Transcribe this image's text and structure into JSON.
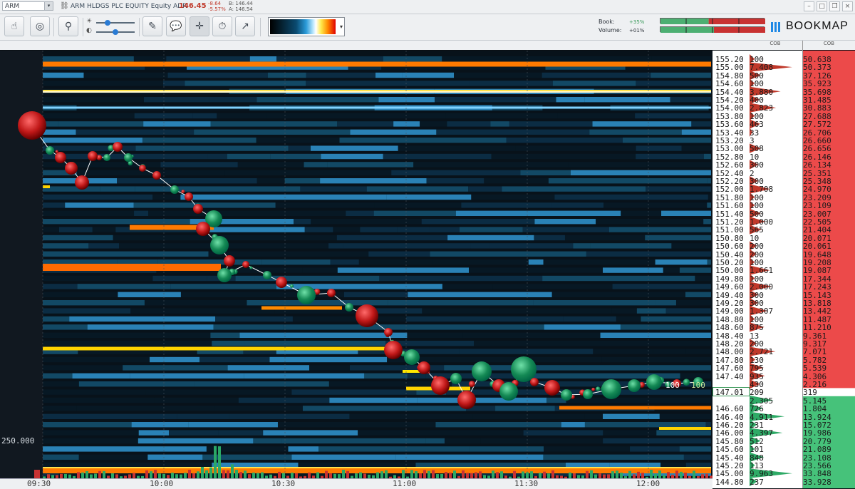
{
  "header": {
    "symbol": "ARM",
    "instrument": "ARM HLDGS PLC EQUITY Equity ADR",
    "last_price": "146.45",
    "change_abs": "-8.64",
    "change_pct": "-5.57%",
    "bid_label": "B: 146.44",
    "ask_label": "A: 146.54"
  },
  "toolbar": {
    "book_label": "Book:",
    "book_value": "+35%",
    "volume_label": "Volume:",
    "volume_value": "+01%",
    "logo_text": "BOOKMAP",
    "book_split": 0.46,
    "volume_split": 0.51,
    "colors": {
      "buy": "#4caf72",
      "sell": "#c83232"
    }
  },
  "icons": [
    "hand-icon",
    "recenter-icon",
    "broom-icon",
    "brightness-icon",
    "contrast-icon",
    "pencil-icon",
    "chat-icon",
    "crosshair-icon",
    "stopwatch-icon",
    "indicator-icon"
  ],
  "chart": {
    "volume_scale_label": "250.000",
    "trade_label_a": "100",
    "trade_label_b": "100",
    "time_ticks": [
      "09:30",
      "10:00",
      "10:30",
      "11:00",
      "11:30",
      "12:00"
    ]
  },
  "ladder": {
    "header_left": "COB",
    "header_right": "COB",
    "current_price": "147.01",
    "current_size": "209",
    "current_cob": "319",
    "asks": [
      {
        "price": "155.20",
        "size": "100",
        "cob": "50.638"
      },
      {
        "price": "155.00",
        "size": "7.408",
        "cob": "50.373"
      },
      {
        "price": "154.80",
        "size": "500",
        "cob": "37.126"
      },
      {
        "price": "154.60",
        "size": "100",
        "cob": "35.923"
      },
      {
        "price": "154.40",
        "size": "3.880",
        "cob": "35.698"
      },
      {
        "price": "154.20",
        "size": "400",
        "cob": "31.485"
      },
      {
        "price": "154.00",
        "size": "2.823",
        "cob": "30.883"
      },
      {
        "price": "153.80",
        "size": "100",
        "cob": "27.688"
      },
      {
        "price": "153.60",
        "size": "463",
        "cob": "27.572"
      },
      {
        "price": "153.40",
        "size": "33",
        "cob": "26.706"
      },
      {
        "price": "153.20",
        "size": "3",
        "cob": "26.660"
      },
      {
        "price": "153.00",
        "size": "508",
        "cob": "26.656"
      },
      {
        "price": "152.80",
        "size": "10",
        "cob": "26.146"
      },
      {
        "price": "152.60",
        "size": "300",
        "cob": "26.134"
      },
      {
        "price": "152.40",
        "size": "2",
        "cob": "25.351"
      },
      {
        "price": "152.20",
        "size": "300",
        "cob": "25.348"
      },
      {
        "price": "152.00",
        "size": "1.708",
        "cob": "24.970"
      },
      {
        "price": "151.80",
        "size": "100",
        "cob": "23.209"
      },
      {
        "price": "151.60",
        "size": "100",
        "cob": "23.109"
      },
      {
        "price": "151.40",
        "size": "500",
        "cob": "23.007"
      },
      {
        "price": "151.20",
        "size": "1.000",
        "cob": "22.505"
      },
      {
        "price": "151.00",
        "size": "565",
        "cob": "21.404"
      },
      {
        "price": "150.80",
        "size": "10",
        "cob": "20.071"
      },
      {
        "price": "150.60",
        "size": "200",
        "cob": "20.061"
      },
      {
        "price": "150.40",
        "size": "200",
        "cob": "19.648"
      },
      {
        "price": "150.20",
        "size": "100",
        "cob": "19.208"
      },
      {
        "price": "150.00",
        "size": "1.661",
        "cob": "19.087"
      },
      {
        "price": "149.80",
        "size": "100",
        "cob": "17.344"
      },
      {
        "price": "149.60",
        "size": "2.000",
        "cob": "17.243"
      },
      {
        "price": "149.40",
        "size": "300",
        "cob": "15.143"
      },
      {
        "price": "149.20",
        "size": "300",
        "cob": "13.818"
      },
      {
        "price": "149.00",
        "size": "1.307",
        "cob": "13.442"
      },
      {
        "price": "148.80",
        "size": "100",
        "cob": "11.487"
      },
      {
        "price": "148.60",
        "size": "875",
        "cob": "11.210"
      },
      {
        "price": "148.40",
        "size": "13",
        "cob": "9.361"
      },
      {
        "price": "148.20",
        "size": "200",
        "cob": "9.317"
      },
      {
        "price": "148.00",
        "size": "2.721",
        "cob": "7.071"
      },
      {
        "price": "147.80",
        "size": "130",
        "cob": "5.782"
      },
      {
        "price": "147.60",
        "size": "795",
        "cob": "5.539"
      },
      {
        "price": "147.40",
        "size": "935",
        "cob": "4.306"
      },
      {
        "price": "",
        "size": "430",
        "cob": "2.216"
      }
    ],
    "bids": [
      {
        "price": "",
        "size": "2.305",
        "cob": "5.145"
      },
      {
        "price": "146.60",
        "size": "726",
        "cob": "1.804"
      },
      {
        "price": "146.40",
        "size": "4.911",
        "cob": "13.924"
      },
      {
        "price": "146.20",
        "size": "231",
        "cob": "15.072"
      },
      {
        "price": "146.00",
        "size": "4.397",
        "cob": "19.986"
      },
      {
        "price": "145.80",
        "size": "512",
        "cob": "20.779"
      },
      {
        "price": "145.60",
        "size": "101",
        "cob": "21.089"
      },
      {
        "price": "145.40",
        "size": "848",
        "cob": "23.108"
      },
      {
        "price": "145.20",
        "size": "113",
        "cob": "23.566"
      },
      {
        "price": "145.00",
        "size": "9.963",
        "cob": "33.848"
      },
      {
        "price": "144.80",
        "size": "237",
        "cob": "33.928"
      }
    ]
  }
}
